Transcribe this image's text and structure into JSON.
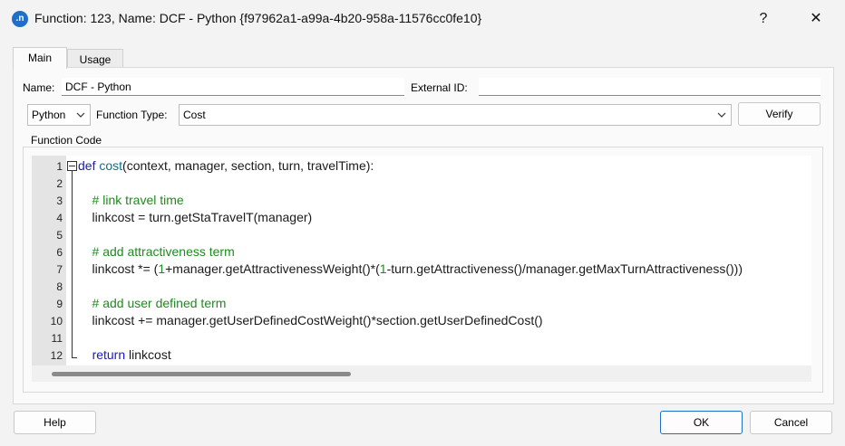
{
  "window": {
    "title": "Function: 123, Name: DCF - Python  {f97962a1-a99a-4b20-958a-11576cc0fe10}",
    "app_icon_text": ".n",
    "help_button": "?",
    "close_button": "✕"
  },
  "tabs": [
    {
      "label": "Main",
      "selected": true
    },
    {
      "label": "Usage",
      "selected": false
    }
  ],
  "form": {
    "name_label": "Name:",
    "name_value": "DCF - Python",
    "external_id_label": "External ID:",
    "external_id_value": "",
    "language_value": "Python",
    "function_type_label": "Function Type:",
    "function_type_value": "Cost",
    "verify_label": "Verify"
  },
  "code_group": {
    "title": "Function Code",
    "lines": [
      {
        "n": "1",
        "text": "def cost(context, manager, section, turn, travelTime):"
      },
      {
        "n": "2",
        "text": ""
      },
      {
        "n": "3",
        "text": "    # link travel time"
      },
      {
        "n": "4",
        "text": "    linkcost = turn.getStaTravelT(manager)"
      },
      {
        "n": "5",
        "text": ""
      },
      {
        "n": "6",
        "text": "    # add attractiveness term"
      },
      {
        "n": "7",
        "text": "    linkcost *= (1+manager.getAttractivenessWeight()*(1-turn.getAttractiveness()/manager.getMaxTurnAttractiveness()))"
      },
      {
        "n": "8",
        "text": ""
      },
      {
        "n": "9",
        "text": "    # add user defined term"
      },
      {
        "n": "10",
        "text": "    linkcost += manager.getUserDefinedCostWeight()*section.getUserDefinedCost()"
      },
      {
        "n": "11",
        "text": ""
      },
      {
        "n": "12",
        "text": "    return linkcost"
      }
    ]
  },
  "footer": {
    "help_label": "Help",
    "ok_label": "OK",
    "cancel_label": "Cancel"
  },
  "colors": {
    "accent": "#1f6fc9",
    "keyword": "#1a1ab8",
    "comment": "#1f8a1f"
  }
}
